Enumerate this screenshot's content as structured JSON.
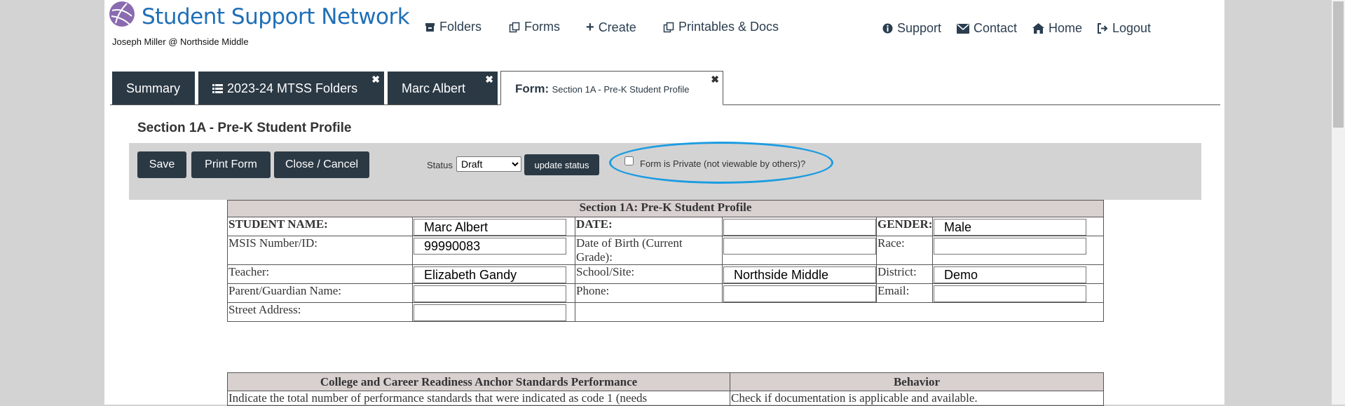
{
  "header": {
    "app_title": "Student Support Network",
    "user_line": "Joseph Miller @ Northside Middle",
    "nav": {
      "folders": "Folders",
      "forms": "Forms",
      "create": "Create",
      "printables": "Printables & Docs",
      "support": "Support",
      "contact": "Contact",
      "home": "Home",
      "logout": "Logout"
    }
  },
  "tabs": {
    "summary": "Summary",
    "folders": "2023-24 MTSS Folders",
    "student": "Marc Albert",
    "active_label": "Form:",
    "active_sub": "Section 1A - Pre-K Student Profile",
    "close_glyph": "✖"
  },
  "section_title": "Section 1A - Pre-K Student Profile",
  "toolbar": {
    "save": "Save",
    "print": "Print Form",
    "close_cancel": "Close / Cancel",
    "status_label": "Status",
    "status_value": "Draft",
    "update_status": "update status",
    "private_label": "Form is Private (not viewable by others)?"
  },
  "profile": {
    "caption": "Section 1A: Pre-K Student Profile",
    "student_name_label": "STUDENT NAME:",
    "student_name": "Marc Albert",
    "date_label": "DATE:",
    "date": "",
    "gender_label": "GENDER:",
    "gender": "Male",
    "msis_label": "MSIS Number/ID:",
    "msis": "99990083",
    "dob_label": "Date of Birth (Current Grade):",
    "dob": "",
    "race_label": "Race:",
    "race": "",
    "teacher_label": "Teacher:",
    "teacher": "Elizabeth Gandy",
    "school_label": "School/Site:",
    "school": "Northside Middle",
    "district_label": "District:",
    "district": "Demo",
    "parent_label": "Parent/Guardian Name:",
    "parent": "",
    "phone_label": "Phone:",
    "phone": "",
    "email_label": "Email:",
    "email": "",
    "address_label": "Street Address:",
    "address": ""
  },
  "standards": {
    "col1_header": "College and Career Readiness Anchor Standards Performance",
    "col2_header": "Behavior",
    "col1_text": "Indicate the total number of performance standards that were indicated as code 1 (needs",
    "col2_text": "Check if documentation is applicable and available."
  },
  "colors": {
    "brand": "#1f6fb7",
    "dark": "#2b3945",
    "highlight": "#1b9ce2"
  }
}
